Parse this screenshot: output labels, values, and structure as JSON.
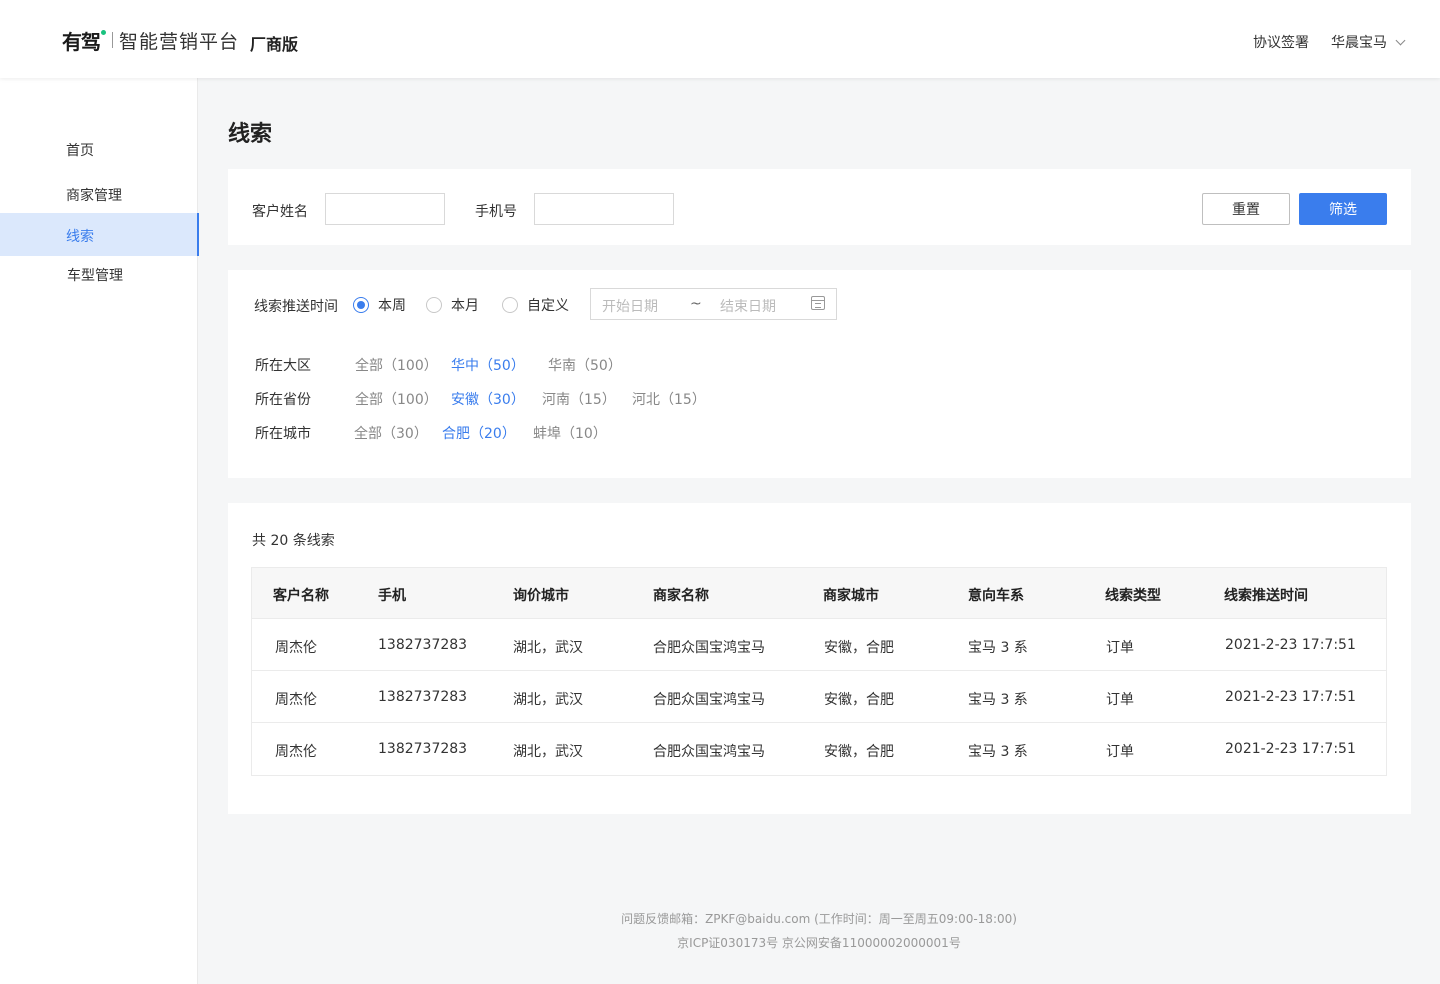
{
  "header": {
    "logo_mark": "有驾",
    "logo_text": "智能营销平台",
    "edition": "厂商版",
    "sign_link": "协议签署",
    "user_name": "华晨宝马"
  },
  "sidebar": {
    "items": [
      {
        "label": "首页",
        "active": false
      },
      {
        "label": "商家管理",
        "active": false
      },
      {
        "label": "线索",
        "active": true
      },
      {
        "label": "车型管理",
        "active": false
      }
    ]
  },
  "page": {
    "title": "线索"
  },
  "search": {
    "name_label": "客户姓名",
    "name_value": "",
    "phone_label": "手机号",
    "phone_value": "",
    "reset_label": "重置",
    "filter_label": "筛选"
  },
  "filters": {
    "time_label": "线索推送时间",
    "time_options": [
      "本周",
      "本月",
      "自定义"
    ],
    "time_selected": "本周",
    "start_placeholder": "开始日期",
    "range_sep": "~",
    "end_placeholder": "结束日期",
    "region": {
      "label": "所在大区",
      "options": [
        "全部（100）",
        "华中（50）",
        "华南（50）"
      ],
      "selected": "华中（50）"
    },
    "province": {
      "label": "所在省份",
      "options": [
        "全部（100）",
        "安徽（30）",
        "河南（15）",
        "河北（15）"
      ],
      "selected": "安徽（30）"
    },
    "city": {
      "label": "所在城市",
      "options": [
        "全部（30）",
        "合肥（20）",
        "蚌埠（10）"
      ],
      "selected": "合肥（20）"
    }
  },
  "results": {
    "count_text": "共 20 条线索",
    "columns": [
      "客户名称",
      "手机",
      "询价城市",
      "商家名称",
      "商家城市",
      "意向车系",
      "线索类型",
      "线索推送时间"
    ],
    "rows": [
      [
        "周杰伦",
        "1382737283",
        "湖北，武汉",
        "合肥众国宝鸿宝马",
        "安徽，合肥",
        "宝马 3 系",
        "订单",
        "2021-2-23 17:7:51"
      ],
      [
        "周杰伦",
        "1382737283",
        "湖北，武汉",
        "合肥众国宝鸿宝马",
        "安徽，合肥",
        "宝马 3 系",
        "订单",
        "2021-2-23 17:7:51"
      ],
      [
        "周杰伦",
        "1382737283",
        "湖北，武汉",
        "合肥众国宝鸿宝马",
        "安徽，合肥",
        "宝马 3 系",
        "订单",
        "2021-2-23 17:7:51"
      ]
    ]
  },
  "footer": {
    "line1": "问题反馈邮箱：ZPKF@baidu.com (工作时间：周一至周五09:00-18:00)",
    "line2": "京ICP证030173号 京公网安备11000002000001号"
  },
  "colors": {
    "accent": "#3a7ded",
    "active_bg": "#dbe8fc",
    "brand_dot": "#19c27f"
  },
  "icons": [
    "chevron-down-icon",
    "calendar-icon",
    "logo-icon"
  ]
}
